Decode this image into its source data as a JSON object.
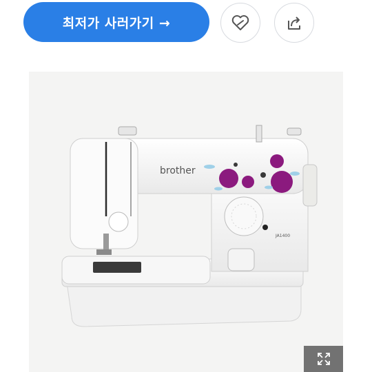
{
  "toolbar": {
    "buy_label": "최저가 사러가기 →",
    "like_icon": "heart-icon",
    "share_icon": "share-icon"
  },
  "product": {
    "brand": "brother",
    "model": "JA1400",
    "expand_icon": "expand-icon"
  },
  "colors": {
    "accent": "#2a7fe6",
    "flower": "#8b1a7e"
  }
}
